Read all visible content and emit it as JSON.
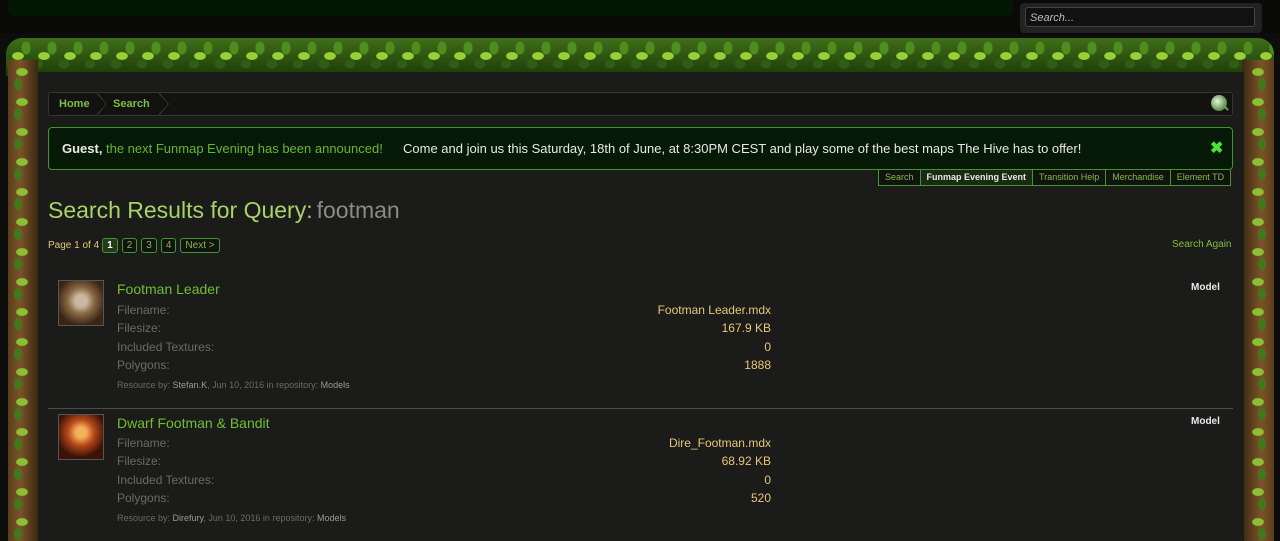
{
  "search": {
    "placeholder": "Search..."
  },
  "breadcrumb": {
    "items": [
      "Home",
      "Search"
    ]
  },
  "notice": {
    "guest": "Guest,",
    "announcement": "the next Funmap Evening has been announced!",
    "body": "Come and join us this Saturday, 18th of June, at 8:30PM CEST and play some of the best maps The Hive has to offer!",
    "close": "✖"
  },
  "notice_tabs": [
    "Search",
    "Funmap Evening Event",
    "Transition Help",
    "Merchandise",
    "Element TD"
  ],
  "page": {
    "title": "Search Results for Query:",
    "query": "footman"
  },
  "pagination": {
    "label": "Page 1 of 4",
    "pages": [
      "1",
      "2",
      "3",
      "4"
    ],
    "current": "1",
    "next": "Next >"
  },
  "search_again": "Search Again",
  "results": [
    {
      "title": "Footman Leader",
      "type": "Model",
      "fields": [
        {
          "label": "Filename:",
          "value": "Footman Leader.mdx"
        },
        {
          "label": "Filesize:",
          "value": "167.9 KB"
        },
        {
          "label": "Included Textures:",
          "value": "0"
        },
        {
          "label": "Polygons:",
          "value": "1888"
        }
      ],
      "meta": {
        "by_label": "Resource by:",
        "author": "Stefan.K",
        "date": ", Jun 10, 2016 in repository: ",
        "repo": "Models"
      }
    },
    {
      "title": "Dwarf Footman & Bandit",
      "type": "Model",
      "fields": [
        {
          "label": "Filename:",
          "value": "Dire_Footman.mdx"
        },
        {
          "label": "Filesize:",
          "value": "68.92 KB"
        },
        {
          "label": "Included Textures:",
          "value": "0"
        },
        {
          "label": "Polygons:",
          "value": "520"
        }
      ],
      "meta": {
        "by_label": "Resource by:",
        "author": "Direfury",
        "date": ", Jun 10, 2016 in repository: ",
        "repo": "Models"
      }
    }
  ]
}
